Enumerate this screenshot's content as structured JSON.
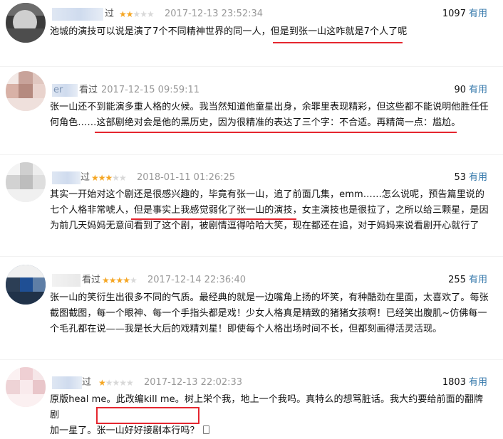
{
  "reviews": [
    {
      "user": "",
      "watched": "过",
      "stars": 2,
      "time": "2017-12-13 23:52:34",
      "votes": "1097",
      "vote_label": "有用",
      "lines": [
        "池城的演技可以说是演了7个不同精神世界的同一人，但是到张一山这咋就是7个人了呢"
      ]
    },
    {
      "user": "er",
      "watched": "看过",
      "stars": 0,
      "time": "2017-12-15 09:59:11",
      "votes": "90",
      "vote_label": "有用",
      "lines": [
        "张一山还不到能演多重人格的火候。我当然知道他童星出身，余罪里表现精彩，但这些都不能说明他胜任任",
        "何角色……这部剧绝对会是他的黑历史，因为很精准的表达了三个字：不合适。再精简一点：尴尬。"
      ]
    },
    {
      "user": "",
      "watched": "过",
      "stars": 3,
      "time": "2018-01-11 01:26:25",
      "votes": "53",
      "vote_label": "有用",
      "lines": [
        "其实一开始对这个剧还是很感兴趣的，毕竟有张一山，追了前面几集，emm……怎么说呢，预告篇里说的",
        "七个人格非常唬人，但是事实上我感觉弱化了张一山的演技，女主演技也是很拉了，之所以给三颗星，是因",
        "为前几天妈妈无意间看到了这个剧，被剧情逗得哈哈大笑，现在都还在追，对于妈妈来说看剧开心就行了"
      ]
    },
    {
      "user": "",
      "watched": "看过",
      "stars": 4,
      "time": "2017-12-14 22:36:40",
      "votes": "255",
      "vote_label": "有用",
      "lines": [
        "张一山的笑衍生出很多不同的气质。最经典的就是一边嘴角上扬的坏笑，有种酷劲在里面，太喜欢了。每张",
        "截图截图，每一个眼神、每一个手指头都是戏！少女人格真是精致的猪猪女孩啊！已经笑出腹肌~仿佛每一",
        "个毛孔都在说——我是长大后的戏精刘星！即使每个人格出场时间不长，但都刻画得活灵活现。"
      ]
    },
    {
      "user": "",
      "watched": "过",
      "stars": 1,
      "time": "2017-12-13 22:02:33",
      "votes": "1803",
      "vote_label": "有用",
      "lines": [
        "原版heal me。此改编kill me。树上栄个我，地上一个我吗。真特么的想骂脏话。我大约要给前面的翻牌剧",
        "加一星了。张一山好好接剧本行吗？"
      ],
      "icon": "mobile-icon"
    }
  ],
  "colors": {
    "accent": "#e5262f",
    "star": "#f5a623",
    "link": "#3377aa"
  }
}
